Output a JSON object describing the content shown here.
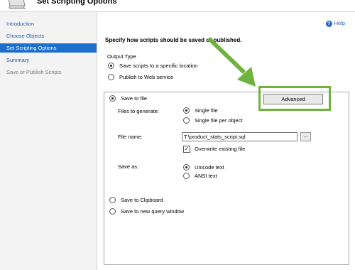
{
  "header": {
    "title": "Set Scripting Options",
    "icon": "scroll-icon"
  },
  "sidebar": {
    "items": [
      {
        "label": "Introduction",
        "state": "link"
      },
      {
        "label": "Choose Objects",
        "state": "link"
      },
      {
        "label": "Set Scripting Options",
        "state": "selected"
      },
      {
        "label": "Summary",
        "state": "link"
      },
      {
        "label": "Save or Publish Scripts",
        "state": "disabled"
      }
    ]
  },
  "help": {
    "label": "Help"
  },
  "instruction": "Specify how scripts should be saved or published.",
  "output_type": {
    "label": "Output Type",
    "options": [
      "Save scripts to a specific location",
      "Publish to Web service"
    ],
    "selected": 0
  },
  "panel": {
    "save_to_file": "Save to file",
    "advanced_label": "Advanced",
    "files_to_generate": {
      "label": "Files to generate:",
      "options": [
        "Single file",
        "Single file per object"
      ],
      "selected": 0
    },
    "file_name": {
      "label": "File name:",
      "value": "T:\\product_stats_script.sql",
      "browse_label": "..."
    },
    "overwrite": {
      "label": "Overwrite existing file",
      "checked": true
    },
    "save_as": {
      "label": "Save as:",
      "options": [
        "Unicode text",
        "ANSI text"
      ],
      "selected": 0
    },
    "save_to_clipboard": "Save to Clipboard",
    "save_to_new_query": "Save to new query window"
  },
  "colors": {
    "accent": "#1c6fcc",
    "highlight": "#6fb33f",
    "link": "#1f5fb0"
  }
}
